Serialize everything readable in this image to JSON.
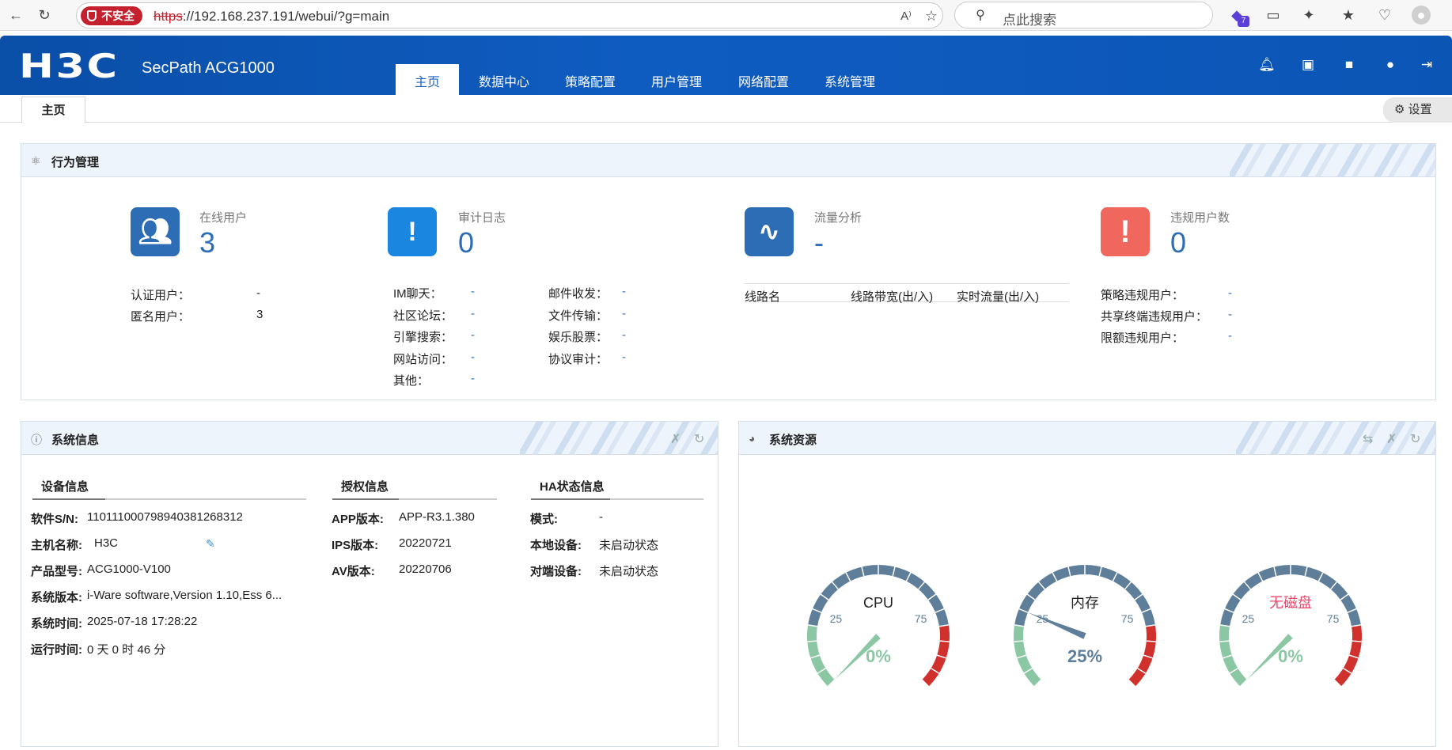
{
  "browser": {
    "insecure_label": "不安全",
    "url_scheme": "https",
    "url_rest": "://192.168.237.191/webui/?g=main",
    "search_placeholder": "点此搜索",
    "ext_badge": "7"
  },
  "header": {
    "logo": "H3C",
    "product": "SecPath ACG1000",
    "nav": [
      "主页",
      "数据中心",
      "策略配置",
      "用户管理",
      "网络配置",
      "系统管理"
    ],
    "active_nav": "主页"
  },
  "tabs": {
    "home": "主页",
    "settings": "设置"
  },
  "behavior": {
    "title": "行为管理",
    "online_users": {
      "label": "在线用户",
      "value": "3",
      "rows": [
        {
          "k": "认证用户：",
          "v": "-"
        },
        {
          "k": "匿名用户：",
          "v": "3"
        }
      ]
    },
    "audit_log": {
      "label": "审计日志",
      "value": "0",
      "left": [
        {
          "k": "IM聊天：",
          "v": "-"
        },
        {
          "k": "社区论坛：",
          "v": "-"
        },
        {
          "k": "引擎搜索：",
          "v": "-"
        },
        {
          "k": "网站访问：",
          "v": "-"
        },
        {
          "k": "其他：",
          "v": "-"
        }
      ],
      "right": [
        {
          "k": "邮件收发：",
          "v": "-"
        },
        {
          "k": "文件传输：",
          "v": "-"
        },
        {
          "k": "娱乐股票：",
          "v": "-"
        },
        {
          "k": "协议审计：",
          "v": "-"
        }
      ]
    },
    "traffic": {
      "label": "流量分析",
      "value": "-",
      "columns": [
        "线路名",
        "线路带宽(出/入)",
        "实时流量(出/入)"
      ]
    },
    "violations": {
      "label": "违规用户数",
      "value": "0",
      "rows": [
        {
          "k": "策略违规用户：",
          "v": "-"
        },
        {
          "k": "共享终端违规用户：",
          "v": "-"
        },
        {
          "k": "限额违规用户：",
          "v": "-"
        }
      ]
    }
  },
  "sysinfo": {
    "title": "系统信息",
    "device": {
      "heading": "设备信息",
      "rows": [
        {
          "k": "软件S/N:",
          "v": "110111000798940381268312"
        },
        {
          "k": "主机名称:",
          "v": "H3C"
        },
        {
          "k": "产品型号:",
          "v": "ACG1000-V100"
        },
        {
          "k": "系统版本:",
          "v": "i-Ware software,Version 1.10,Ess 6..."
        },
        {
          "k": "系统时间:",
          "v": "2025-07-18 17:28:22"
        },
        {
          "k": "运行时间:",
          "v": "0 天 0 时 46 分"
        }
      ]
    },
    "license": {
      "heading": "授权信息",
      "rows": [
        {
          "k": "APP版本:",
          "v": "APP-R3.1.380"
        },
        {
          "k": "IPS版本:",
          "v": "20220721"
        },
        {
          "k": "AV版本:",
          "v": "20220706"
        }
      ]
    },
    "ha": {
      "heading": "HA状态信息",
      "rows": [
        {
          "k": "模式:",
          "v": "-"
        },
        {
          "k": "本地设备:",
          "v": "未启动状态"
        },
        {
          "k": "对端设备:",
          "v": "未启动状态"
        }
      ]
    }
  },
  "resources": {
    "title": "系统资源",
    "gauges": [
      {
        "label": "CPU",
        "value": 0,
        "display": "0%",
        "label_color": "#222222",
        "value_color": "#8cc7a3"
      },
      {
        "label": "内存",
        "value": 25,
        "display": "25%",
        "label_color": "#222222",
        "value_color": "#5f7e99"
      },
      {
        "label": "无磁盘",
        "value": 0,
        "display": "0%",
        "label_color": "#e8476b",
        "value_color": "#8cc7a3"
      }
    ],
    "tick_25": "25",
    "tick_75": "75"
  },
  "colors": {
    "brand_blue": "#0f5cc1",
    "violation_red": "#f0685d",
    "gauge_green": "#8cc7a3",
    "gauge_slate": "#5f7e99",
    "gauge_red": "#d0312d"
  }
}
